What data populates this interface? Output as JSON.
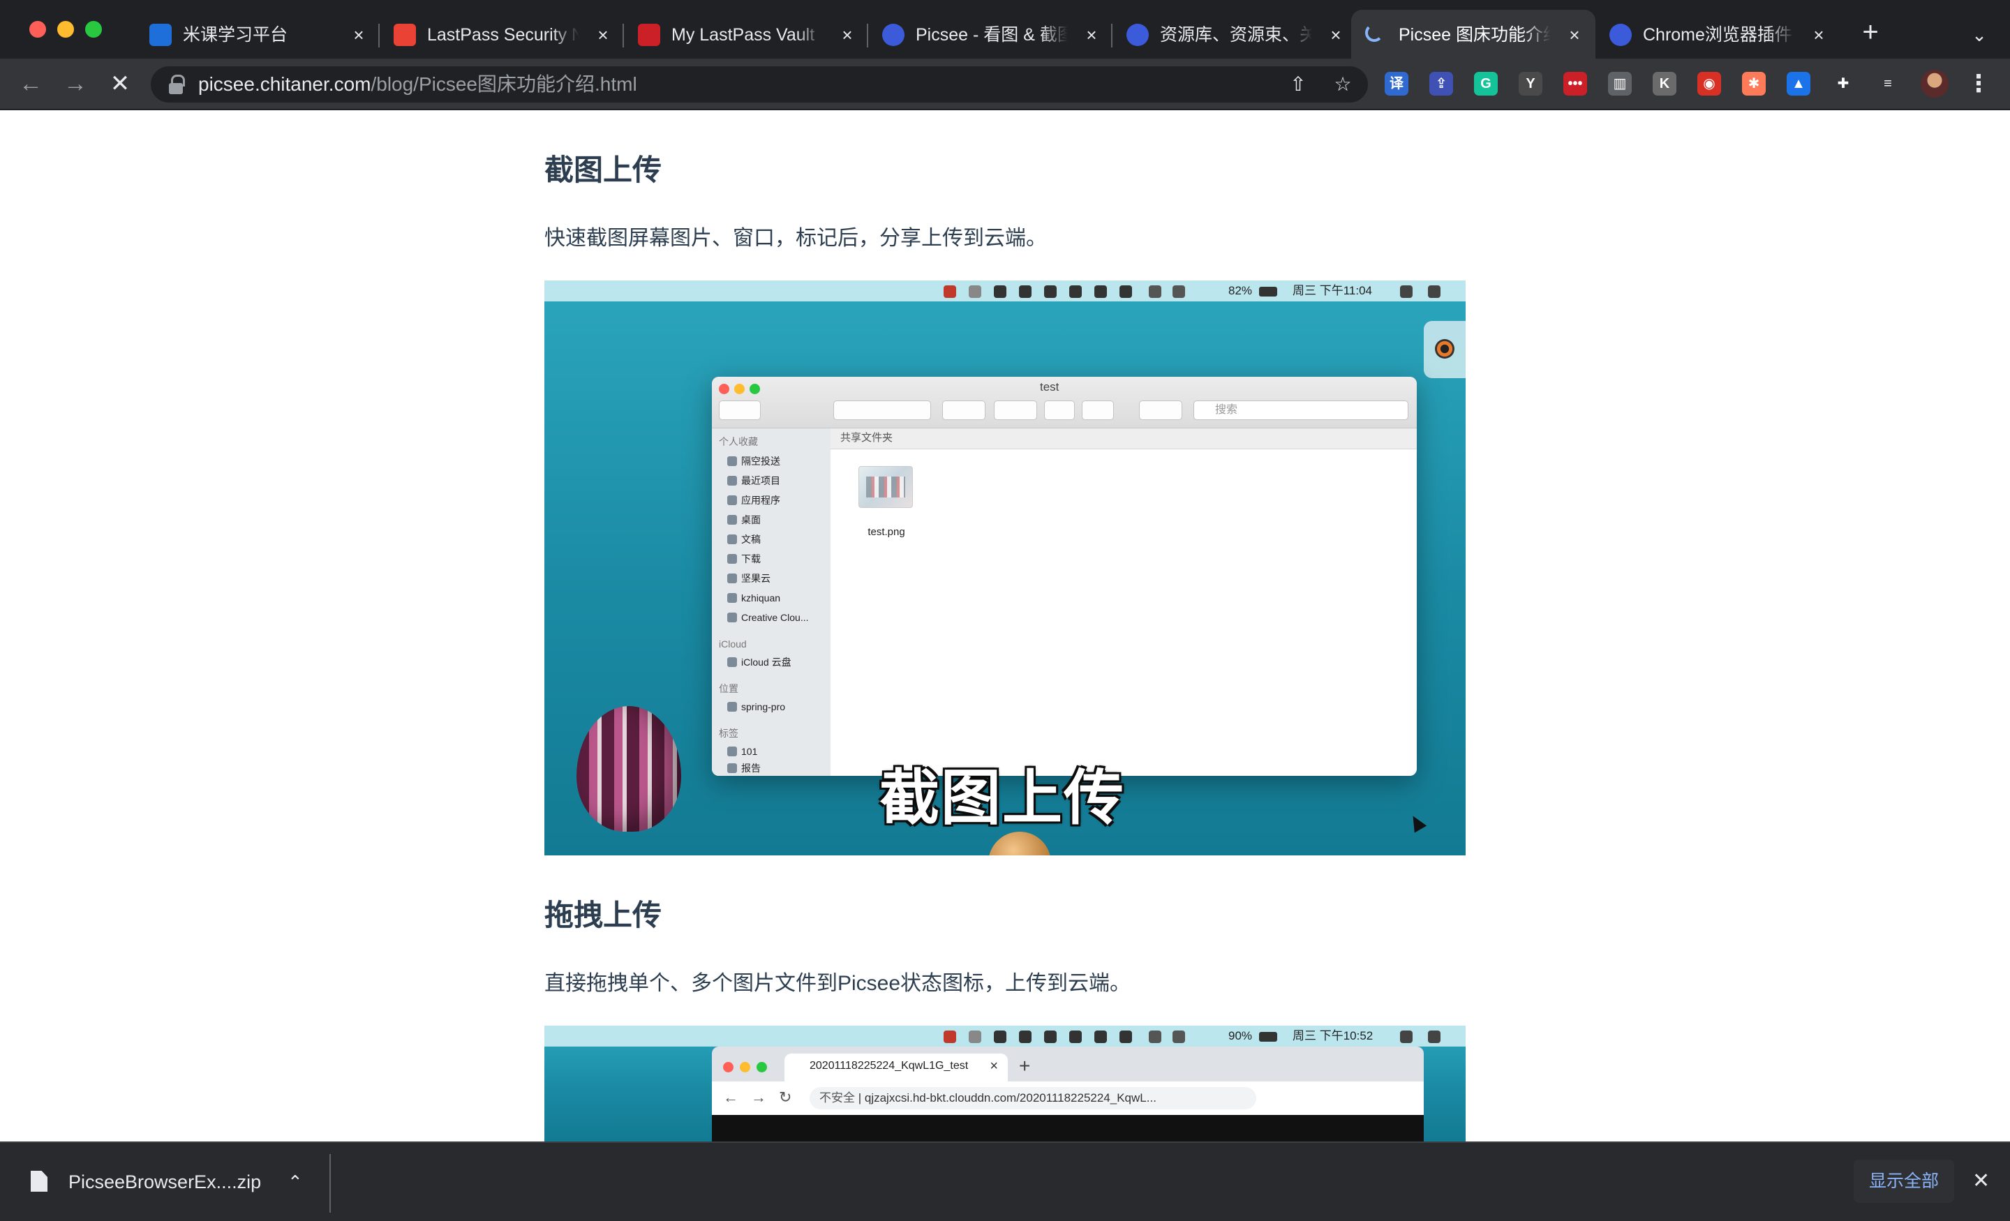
{
  "tabs": [
    {
      "title": "米课学习平台",
      "icon": "m-icon",
      "color": "#1e6fd9",
      "active": false
    },
    {
      "title": "LastPass Security N",
      "icon": "gmail-icon",
      "color": "#ea4335",
      "active": false
    },
    {
      "title": "My LastPass Vault",
      "icon": "lastpass-icon",
      "color": "#cc2029",
      "active": false
    },
    {
      "title": "Picsee - 看图 & 截图",
      "icon": "picsee-icon",
      "color": "#3b5bdb",
      "active": false
    },
    {
      "title": "资源库、资源束、关",
      "icon": "picsee-icon",
      "color": "#3b5bdb",
      "active": false
    },
    {
      "title": "Picsee 图床功能介绍",
      "icon": "loading-icon",
      "color": "#8ab4f8",
      "active": true
    },
    {
      "title": "Chrome浏览器插件",
      "icon": "picsee-icon",
      "color": "#3b5bdb",
      "active": false
    }
  ],
  "toolbar": {
    "url_host": "picsee.chitaner.com",
    "url_path": "/blog/Picsee图床功能介绍.html",
    "back_icon": "←",
    "forward_icon": "→",
    "stop_icon": "✕"
  },
  "extensions": [
    {
      "name": "translate-ext-icon",
      "glyph": "译",
      "color": "#2f6ad0"
    },
    {
      "name": "uploader-ext-icon",
      "glyph": "⇪",
      "color": "#3f51b5"
    },
    {
      "name": "grammarly-ext-icon",
      "glyph": "G",
      "color": "#15c39a"
    },
    {
      "name": "ylab-ext-icon",
      "glyph": "Y",
      "color": "#4a4a4a"
    },
    {
      "name": "lastpass-ext-icon",
      "glyph": "•••",
      "color": "#cc2029"
    },
    {
      "name": "trash-ext-icon",
      "glyph": "▥",
      "color": "#5f6368"
    },
    {
      "name": "k-ext-icon",
      "glyph": "K",
      "color": "#6b6b6b"
    },
    {
      "name": "pokeball-ext-icon",
      "glyph": "◉",
      "color": "#d93025"
    },
    {
      "name": "hubspot-ext-icon",
      "glyph": "✱",
      "color": "#ff7a59"
    },
    {
      "name": "mountain-ext-icon",
      "glyph": "▲",
      "color": "#1a73e8"
    },
    {
      "name": "puzzle-ext-icon",
      "glyph": "✚",
      "color": "#35363a"
    },
    {
      "name": "playlist-ext-icon",
      "glyph": "≡",
      "color": "#35363a"
    }
  ],
  "article": {
    "section1_title": "截图上传",
    "section1_text": "快速截图屏幕图片、窗口，标记后，分享上传到云端。",
    "section2_title": "拖拽上传",
    "section2_text": "直接拖拽单个、多个图片文件到Picsee状态图标，上传到云端。"
  },
  "shot1": {
    "battery": "82%",
    "clock": "周三 下午11:04",
    "finder_title": "test",
    "search_placeholder": "搜索",
    "favorites_header": "个人收藏",
    "favorites": [
      "隔空投送",
      "最近项目",
      "应用程序",
      "桌面",
      "文稿",
      "下载",
      "坚果云",
      "kzhiquan",
      "Creative Clou..."
    ],
    "icloud_header": "iCloud",
    "icloud_items": [
      "iCloud 云盘"
    ],
    "locations_header": "位置",
    "locations": [
      "spring-pro"
    ],
    "tags_header": "标签",
    "tags": [
      "101",
      "报告"
    ],
    "folder_header": "共享文件夹",
    "file_name": "test.png",
    "subtitle": "截图上传"
  },
  "shot2": {
    "battery": "90%",
    "clock": "周三 下午10:52",
    "tab_title": "20201118225224_KqwL1G_test",
    "not_secure": "不安全",
    "url": "qjzajxcsi.hd-bkt.clouddn.com/20201118225224_KqwL..."
  },
  "download": {
    "file_name": "PicseeBrowserEx....zip",
    "show_all": "显示全部"
  }
}
